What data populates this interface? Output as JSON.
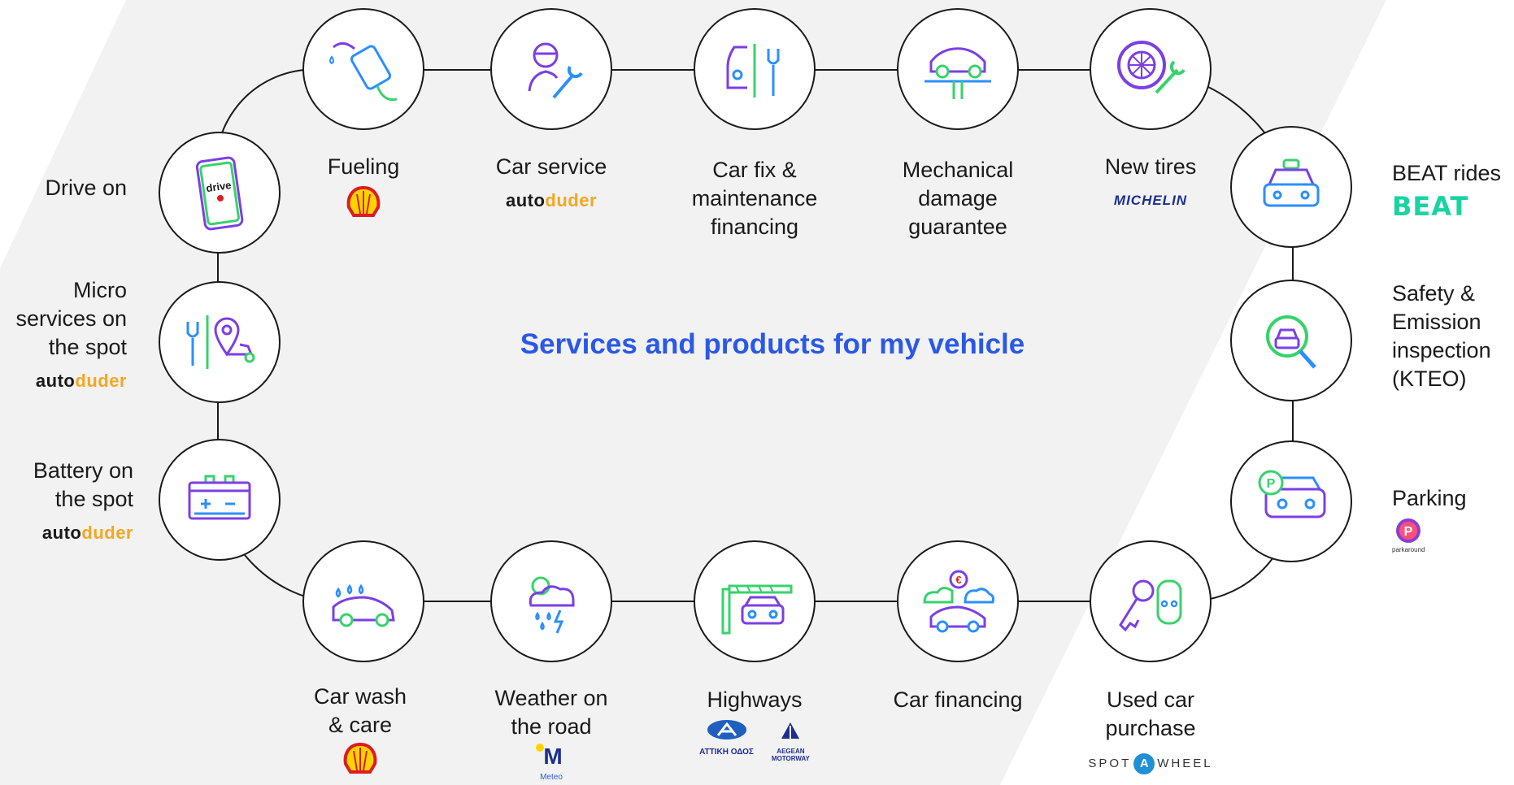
{
  "colors": {
    "purple": "#7b3fe4",
    "green": "#36d36b",
    "blue": "#2b8fff",
    "title": "#2b59e6",
    "yellow": "#ffd400",
    "red": "#dd1d21"
  },
  "title": "Services and products for my vehicle",
  "nodes": {
    "drive_on": {
      "label": "Drive on",
      "icon": "phone-drive-icon",
      "app_text": "drive"
    },
    "fueling": {
      "label": "Fueling",
      "icon": "fuel-pump-icon",
      "logo": "shell-logo"
    },
    "car_service": {
      "label": "Car service",
      "icon": "mechanic-wrench-icon",
      "logo_a": "auto",
      "logo_b": "duder"
    },
    "car_fix_financing": {
      "label": "Car fix &\nmaintenance\nfinancing",
      "icon": "car-repair-icon"
    },
    "mech_guarantee": {
      "label": "Mechanical\ndamage\nguarantee",
      "icon": "car-lift-icon"
    },
    "new_tires": {
      "label": "New tires",
      "icon": "tire-wrench-icon",
      "logo": "MICHELIN"
    },
    "beat_rides": {
      "label": "BEAT rides",
      "icon": "taxi-icon",
      "logo": "BEAT"
    },
    "kteo": {
      "label": "Safety &\nEmission\ninspection\n(KTEO)",
      "icon": "car-inspection-icon"
    },
    "parking": {
      "label": "Parking",
      "icon": "parking-car-icon",
      "logo_caption": "parkaround"
    },
    "micro_services": {
      "label": "Micro\nservices on\nthe spot",
      "icon": "location-service-icon",
      "logo_a": "auto",
      "logo_b": "duder"
    },
    "battery": {
      "label": "Battery on\nthe spot",
      "icon": "battery-icon",
      "logo_a": "auto",
      "logo_b": "duder"
    },
    "car_wash": {
      "label": "Car wash\n& care",
      "icon": "car-wash-icon",
      "logo": "shell-logo"
    },
    "weather": {
      "label": "Weather on\nthe road",
      "icon": "weather-icon",
      "logo_letter": "M",
      "logo_caption": "Meteo"
    },
    "highways": {
      "label": "Highways",
      "icon": "toll-barrier-icon",
      "logo1": "ΑΤΤΙΚΗ ΟΔΟΣ",
      "logo2_a": "AEGEAN",
      "logo2_b": "MOTORWAY"
    },
    "car_financing": {
      "label": "Car financing",
      "icon": "car-finance-icon",
      "currency": "€"
    },
    "used_car": {
      "label": "Used car\npurchase",
      "icon": "car-key-icon",
      "logo_a": "SPOT",
      "logo_mid": "A",
      "logo_b": "WHEEL"
    }
  }
}
